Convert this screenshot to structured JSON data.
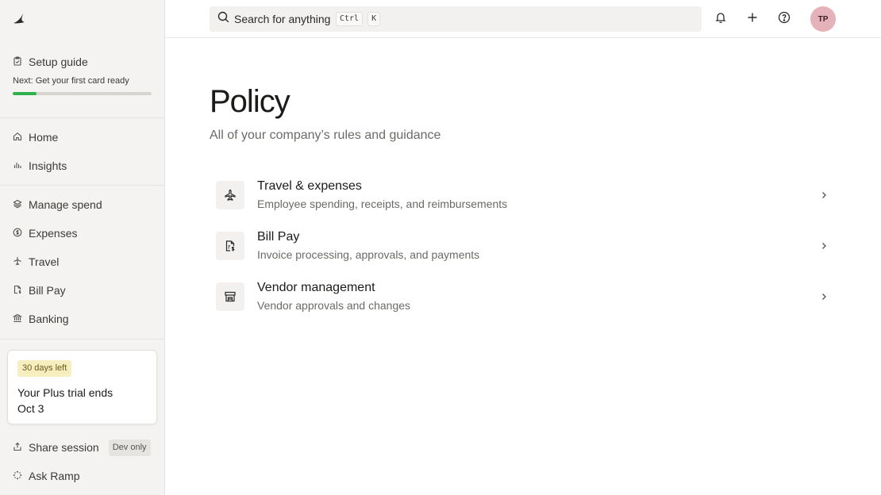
{
  "sidebar": {
    "setup": {
      "title": "Setup guide",
      "next": "Next: Get your first card ready",
      "progress": 0.17
    },
    "nav_primary": [
      {
        "label": "Home",
        "icon": "home-icon"
      },
      {
        "label": "Insights",
        "icon": "bar-chart-icon"
      }
    ],
    "nav_spend": [
      {
        "label": "Manage spend",
        "icon": "layers-icon"
      },
      {
        "label": "Expenses",
        "icon": "dollar-circle-icon"
      },
      {
        "label": "Travel",
        "icon": "plane-icon"
      },
      {
        "label": "Bill Pay",
        "icon": "bill-icon"
      },
      {
        "label": "Banking",
        "icon": "bank-icon"
      }
    ],
    "trial": {
      "badge": "30 days left",
      "line1": "Your Plus trial ends",
      "line2": "Oct 3"
    },
    "bottom": [
      {
        "label": "Share session",
        "badge": "Dev only",
        "icon": "share-icon"
      },
      {
        "label": "Ask Ramp",
        "icon": "sparkle-icon"
      }
    ]
  },
  "topbar": {
    "search_placeholder": "Search for anything",
    "shortcut_keys": [
      "Ctrl",
      "K"
    ],
    "avatar_initials": "TP"
  },
  "main": {
    "title": "Policy",
    "subtitle": "All of your company’s rules and guidance",
    "items": [
      {
        "title": "Travel & expenses",
        "desc": "Employee spending, receipts, and reimbursements",
        "icon": "plane-icon"
      },
      {
        "title": "Bill Pay",
        "desc": "Invoice processing, approvals, and payments",
        "icon": "bill-icon"
      },
      {
        "title": "Vendor management",
        "desc": "Vendor approvals and changes",
        "icon": "storefront-icon"
      }
    ]
  },
  "colors": {
    "accent_green": "#2fb24c",
    "sidebar_bg": "#f4f3f1",
    "avatar_bg": "#e5b2b9",
    "trial_badge_bg": "#f7eec0"
  }
}
